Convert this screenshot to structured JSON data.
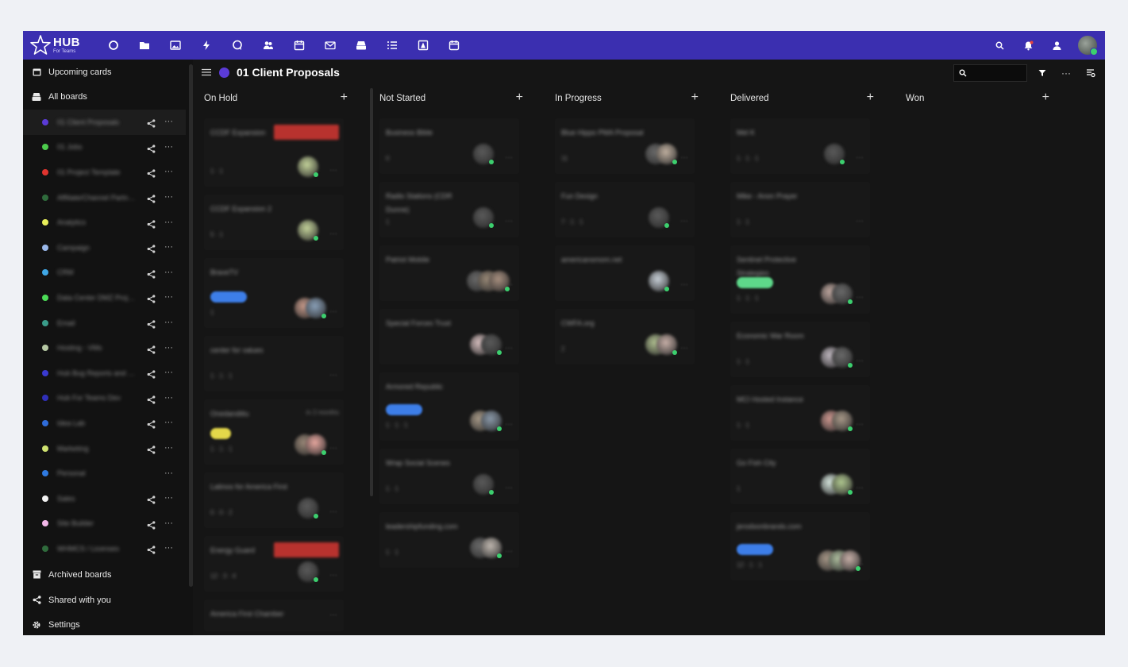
{
  "app": {
    "logo_text": "HUB",
    "logo_sub": "For Teams",
    "nav_icons": [
      "circle-icon",
      "folder-icon",
      "image-icon",
      "bolt-icon",
      "chat-icon",
      "people-icon",
      "calendar-icon",
      "mail-icon",
      "boards-icon",
      "list-icon",
      "contact-icon",
      "schedule-icon"
    ],
    "top_right_icons": [
      "search-icon",
      "notification-icon",
      "user-icon",
      "profile-avatar"
    ]
  },
  "sidebar": {
    "upcoming_label": "Upcoming cards",
    "all_boards_label": "All boards",
    "boards": [
      {
        "name": "01 Client Proposals",
        "color": "#5b3bd6"
      },
      {
        "name": "01 Jobs",
        "color": "#4ccb4c"
      },
      {
        "name": "01 Project Template",
        "color": "#e0342f"
      },
      {
        "name": "Affiliate/Channel Partners",
        "color": "#2f6b3c"
      },
      {
        "name": "Analytics",
        "color": "#e8ef5a"
      },
      {
        "name": "Campaign",
        "color": "#9ab8ea"
      },
      {
        "name": "CRM",
        "color": "#3fa7e6"
      },
      {
        "name": "Data Center DMZ Project",
        "color": "#4cdc57"
      },
      {
        "name": "Email",
        "color": "#3a9c8a"
      },
      {
        "name": "Hosting - VMs",
        "color": "#b6c8a4"
      },
      {
        "name": "Hub Bug Reports and Issues",
        "color": "#3a3ad0"
      },
      {
        "name": "Hub For Teams Dev",
        "color": "#2f2fb8"
      },
      {
        "name": "Idea Lab",
        "color": "#2f6cda"
      },
      {
        "name": "Marketing",
        "color": "#cfe270"
      },
      {
        "name": "Personal",
        "color": "#2f7ae0"
      },
      {
        "name": "Sales",
        "color": "#f2f2f2"
      },
      {
        "name": "Site Builder",
        "color": "#f2b7e8"
      },
      {
        "name": "WHMCS / Licenses",
        "color": "#2f6b3c"
      }
    ],
    "archived_label": "Archived boards",
    "shared_label": "Shared with you",
    "settings_label": "Settings"
  },
  "board": {
    "title": "01 Client Proposals",
    "search_placeholder": "",
    "columns": [
      {
        "title": "On Hold"
      },
      {
        "title": "Not Started"
      },
      {
        "title": "In Progress"
      },
      {
        "title": "Delivered"
      },
      {
        "title": "Won"
      }
    ],
    "cards": {
      "on_hold": [
        {
          "title": "CCDF Expansion",
          "meta": "1  ·  1"
        },
        {
          "title": "CCDF Expansion 2",
          "meta": "5  ·  1"
        },
        {
          "title": "BraveTV",
          "meta": "1"
        },
        {
          "title": "center for values",
          "meta": "1  ·  1  ·  1"
        },
        {
          "title": "Onedandiitu",
          "meta": "1  ·  1  ·  1",
          "due": "in 2 months"
        },
        {
          "title": "Latinos for America First",
          "meta": "0  ·  0  ·  2"
        },
        {
          "title": "Energy Guard",
          "meta": "12  ·  3  ·  4"
        },
        {
          "title": "America First Chamber",
          "meta": ""
        }
      ],
      "not_started": [
        {
          "title": "Business Bible",
          "meta": "0"
        },
        {
          "title": "Radio Stations (CDR Dunne)",
          "meta": "1"
        },
        {
          "title": "Patriot Mobile",
          "meta": ""
        },
        {
          "title": "Special Forces Trust",
          "meta": ""
        },
        {
          "title": "Armored Republic",
          "meta": "1  ·  1  ·  1"
        },
        {
          "title": "Wrap Social Scenes",
          "meta": "1  ·  1"
        },
        {
          "title": "leadershipfunding.com",
          "meta": "1  ·  1"
        }
      ],
      "in_progress": [
        {
          "title": "Blue Hippo PMA Proposal",
          "meta": "11"
        },
        {
          "title": "Fun Design",
          "meta": "7  ·  1  ·  1"
        },
        {
          "title": "americansmom.net",
          "meta": ""
        },
        {
          "title": "CWFA.org",
          "meta": "2"
        }
      ],
      "delivered": [
        {
          "title": "Mel K",
          "meta": "1  ·  1  ·  1"
        },
        {
          "title": "Mike - Anon Prayer",
          "meta": "1  ·  1"
        },
        {
          "title": "Sentinel Protective Strategies",
          "meta": "1  ·  1  ·  1"
        },
        {
          "title": "Economic War Room",
          "meta": "1  ·  1"
        },
        {
          "title": "MCI Hosted Instance",
          "meta": "1  ·  1"
        },
        {
          "title": "Go Fish City",
          "meta": "1"
        },
        {
          "title": "jerodsonbrands.com",
          "meta": "12  ·  1  ·  1"
        }
      ]
    }
  }
}
